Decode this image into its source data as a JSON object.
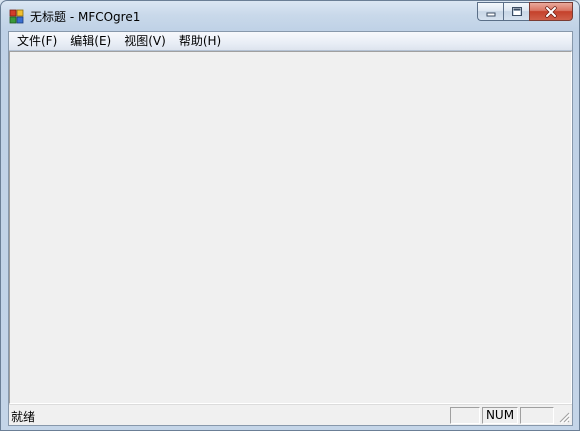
{
  "window": {
    "title": "无标题 - MFCOgre1",
    "app_icon": "mfc-app-icon"
  },
  "caption_buttons": {
    "minimize_icon": "minimize-icon",
    "maximize_icon": "maximize-icon",
    "close_icon": "close-icon"
  },
  "menu": {
    "items": [
      {
        "label": "文件(F)"
      },
      {
        "label": "编辑(E)"
      },
      {
        "label": "视图(V)"
      },
      {
        "label": "帮助(H)"
      }
    ]
  },
  "statusbar": {
    "message": "就绪",
    "indicators": {
      "caps": "",
      "num": "NUM",
      "scroll": ""
    },
    "grip_icon": "size-grip-icon"
  },
  "colors": {
    "titlebar_top": "#dbe7f3",
    "titlebar_bottom": "#bfd1e6",
    "close_button": "#c4402a",
    "client_background": "#f0f0f0"
  }
}
